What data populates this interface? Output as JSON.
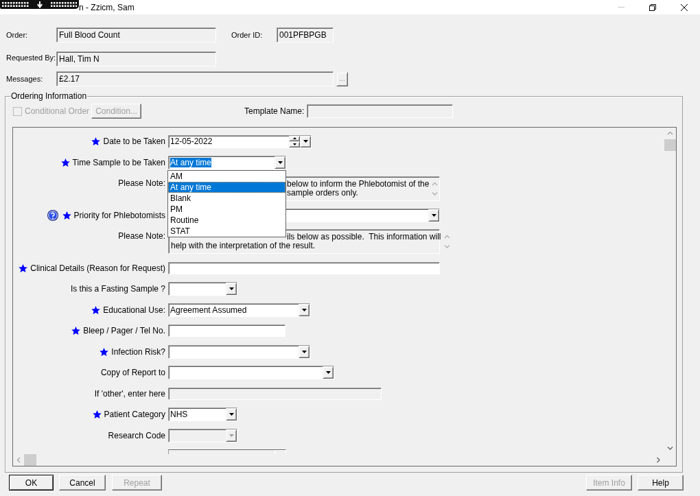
{
  "window": {
    "title": "n - Zzicm, Sam"
  },
  "header": {
    "order": {
      "label": "Order:",
      "value": "Full Blood Count"
    },
    "order_id": {
      "label": "Order ID:",
      "value": "001PFBPGB"
    },
    "requested_by": {
      "label": "Requested By:",
      "value": "Hall, Tim N"
    },
    "messages": {
      "label": "Messages:",
      "value": "£2.17",
      "button": {
        "label": "...",
        "disabled": true
      }
    }
  },
  "ordering_information": {
    "title": "Ordering Information",
    "conditional_order": {
      "label": "Conditional Order",
      "checked": false,
      "disabled": true
    },
    "condition_button": {
      "label": "Condition...",
      "disabled": true
    },
    "template_name": {
      "label": "Template Name:"
    }
  },
  "form_rows": [
    {
      "kind": "date",
      "label": "Date to be Taken",
      "required": true,
      "help": false,
      "value": "12-05-2022",
      "disabled": false
    },
    {
      "kind": "dropdown",
      "label": "Time Sample to be Taken",
      "required": true,
      "help": false,
      "value": "At any time",
      "highlighted": true,
      "disabled": false,
      "expanded": true,
      "options": [
        {
          "label": "AM",
          "selected": false
        },
        {
          "label": "At any time",
          "selected": true
        },
        {
          "label": "Blank",
          "selected": false
        },
        {
          "label": "PM",
          "selected": false
        },
        {
          "label": "Routine",
          "selected": false
        },
        {
          "label": "STAT",
          "selected": false
        }
      ]
    },
    {
      "kind": "note",
      "label": "Please Note:",
      "lines": [
        "below to inform the Phlebotomist of the",
        "sample orders only."
      ]
    },
    {
      "kind": "dropdown",
      "label": "Priority for Phlebotomists",
      "required": true,
      "help": true,
      "disabled": false,
      "expanded": false
    },
    {
      "kind": "note",
      "label": "Please Note:",
      "lines": [
        "ils below as possible.  This information will",
        "help with the interpretation of the result."
      ]
    },
    {
      "kind": "text",
      "label": "Clinical Details (Reason for Request)",
      "required": true,
      "help": false,
      "disabled": false
    },
    {
      "kind": "dropdown",
      "label": "Is this a Fasting Sample ?",
      "required": false,
      "help": false,
      "disabled": false,
      "expanded": false
    },
    {
      "kind": "dropdown",
      "label": "Educational Use:",
      "required": true,
      "help": false,
      "value": "Agreement Assumed",
      "highlighted": false,
      "disabled": false,
      "expanded": false
    },
    {
      "kind": "text",
      "label": "Bleep / Pager / Tel No.",
      "required": true,
      "help": false,
      "disabled": false
    },
    {
      "kind": "dropdown",
      "label": "Infection Risk?",
      "required": true,
      "help": false,
      "disabled": false,
      "expanded": false
    },
    {
      "kind": "dropdown",
      "label": "Copy of Report to",
      "required": false,
      "help": false,
      "disabled": false,
      "expanded": false
    },
    {
      "kind": "text",
      "label": "If 'other', enter here",
      "required": false,
      "help": false,
      "disabled": true
    },
    {
      "kind": "dropdown",
      "label": "Patient Category",
      "required": true,
      "help": false,
      "value": "NHS",
      "highlighted": false,
      "disabled": false,
      "expanded": false
    },
    {
      "kind": "dropdown",
      "label": "Research Code",
      "required": false,
      "help": false,
      "disabled": true,
      "expanded": false
    },
    {
      "kind": "partial"
    }
  ],
  "left_buttons": [
    {
      "label": "OK",
      "disabled": false,
      "default": true
    },
    {
      "label": "Cancel",
      "disabled": false,
      "default": false
    },
    {
      "label": "Repeat",
      "disabled": true,
      "default": false
    }
  ],
  "right_buttons": [
    {
      "label": "Item Info",
      "disabled": true,
      "default": false
    },
    {
      "label": "Help",
      "disabled": false,
      "default": false
    }
  ]
}
